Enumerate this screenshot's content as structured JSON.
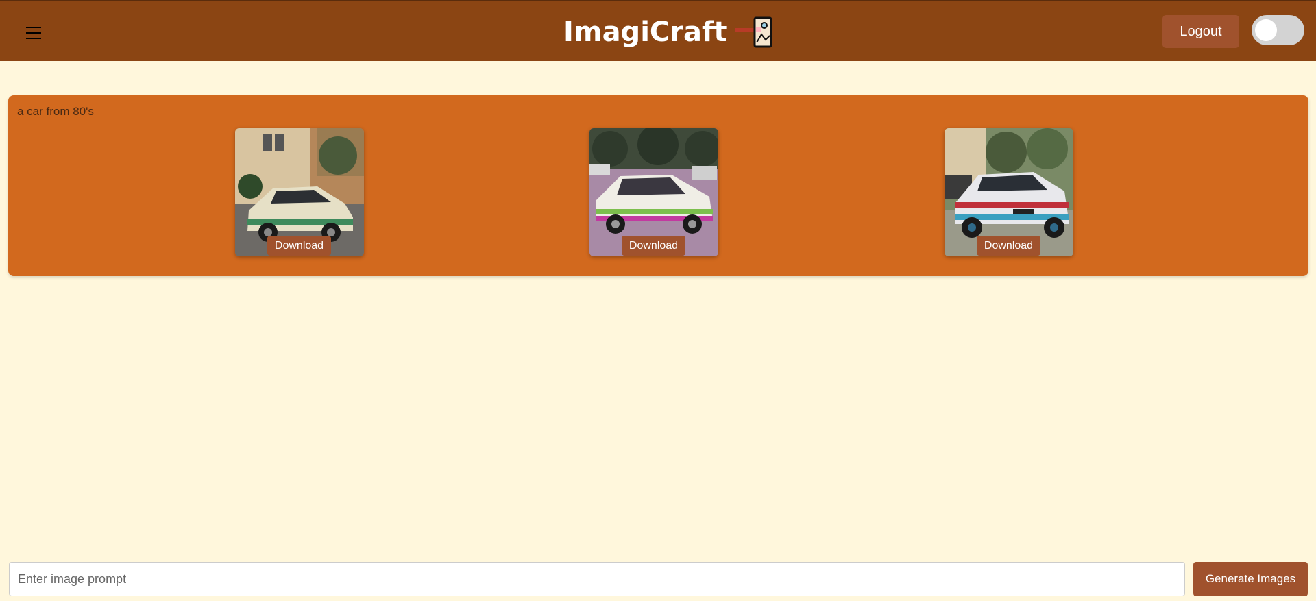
{
  "header": {
    "menu_icon": "hamburger-icon",
    "title": "ImagiCraft",
    "logo_icon": "photo-frame-icon",
    "logout_label": "Logout",
    "theme_toggle": {
      "state": "off"
    }
  },
  "results": [
    {
      "prompt": "a car from 80's",
      "images": [
        {
          "download_label": "Download"
        },
        {
          "download_label": "Download"
        },
        {
          "download_label": "Download"
        }
      ]
    }
  ],
  "composer": {
    "placeholder": "Enter image prompt",
    "value": "",
    "generate_label": "Generate Images"
  },
  "colors": {
    "header_bg": "#8b4513",
    "page_bg": "#fff7dc",
    "card_bg": "#d2691e",
    "button_bg": "#a0522d"
  }
}
